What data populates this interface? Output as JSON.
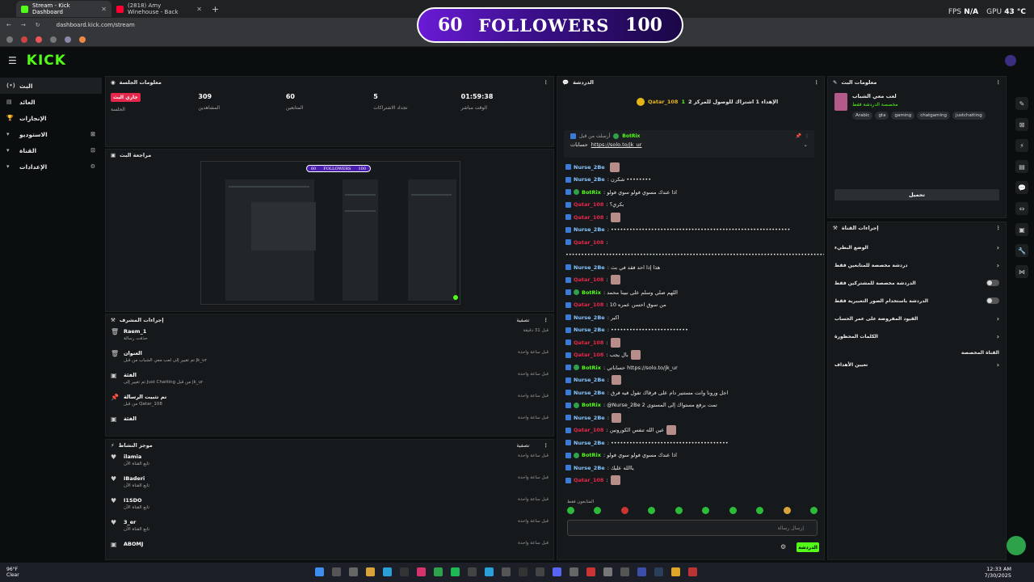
{
  "browser": {
    "tabs": [
      {
        "label": "Stream - Kick Dashboard",
        "color": "#53fc18"
      },
      {
        "label": "(2818) Amy Winehouse - Back",
        "color": "#ff0033"
      }
    ],
    "url": "dashboard.kick.com/stream",
    "fps_label": "FPS",
    "fps_value": "N/A",
    "gpu_label": "GPU",
    "gpu_value": "43 °C"
  },
  "overlay": {
    "current": "60",
    "label": "FOLLOWERS",
    "goal": "100"
  },
  "kick": {
    "logo": "KICK"
  },
  "nav": {
    "items": [
      {
        "label": "البث",
        "icon": "(•)"
      },
      {
        "label": "العائد",
        "icon": "▤"
      },
      {
        "label": "الإنجازات",
        "icon": "🏆"
      },
      {
        "label": "الاستوديو",
        "icon": "▾"
      },
      {
        "label": "القناة",
        "icon": "▾"
      },
      {
        "label": "الإعدادات",
        "icon": "▾"
      }
    ]
  },
  "session": {
    "title": "معلومات الجلسة",
    "live_badge": "جاري البث",
    "live_label": "الجلسة",
    "stats": [
      {
        "value": "309",
        "label": "المشاهدين"
      },
      {
        "value": "60",
        "label": "المتابعين"
      },
      {
        "value": "5",
        "label": "تجداد الاشتراكات"
      },
      {
        "value": "01:59:38",
        "label": "الوقت مباشر"
      }
    ]
  },
  "preview": {
    "title": "مراجعة البث",
    "overlay_current": "60",
    "overlay_label": "FOLLOWERS",
    "overlay_goal": "100"
  },
  "mod_actions": {
    "title": "إجراءات المشرف",
    "filter": "تصفية",
    "rows": [
      {
        "icon": "🗑",
        "title": "Raem_1",
        "sub": "حذفت رسالة",
        "time": "قبل 31 دقيقة"
      },
      {
        "icon": "🗑",
        "title": "العنوان",
        "sub": "تم تغيير إلى لعب معي الشباب من قبل jk_ur",
        "time": "قبل ساعة واحدة"
      },
      {
        "icon": "▣",
        "title": "الفئة",
        "sub": "تم تغيير إلى Just Chatting من قبل jk_ur",
        "time": "قبل ساعة واحدة"
      },
      {
        "icon": "📌",
        "title": "تم تثبيت الرسالة",
        "sub": "من قبل Qatar_108",
        "time": "قبل ساعة واحدة"
      },
      {
        "icon": "▣",
        "title": "الفئة",
        "sub": "",
        "time": "قبل ساعة واحدة"
      }
    ]
  },
  "activity": {
    "title": "موجز النشاط",
    "filter": "تصفية",
    "rows": [
      {
        "name": "ilamia",
        "sub": "تابع القناة الآن",
        "time": "قبل ساعة واحدة"
      },
      {
        "name": "IBaderi",
        "sub": "تابع القناة الآن",
        "time": "قبل ساعة واحدة"
      },
      {
        "name": "I1SDO",
        "sub": "تابع القناة الآن",
        "time": "قبل ساعة واحدة"
      },
      {
        "name": "3_er",
        "sub": "تابع القناة الآن",
        "time": "قبل ساعة واحدة"
      },
      {
        "name": "ABOMJ",
        "sub": "",
        "time": "قبل ساعة واحدة"
      }
    ]
  },
  "chat": {
    "title": "الدردشة",
    "top_user": "Qatar_108",
    "top_count": "1",
    "top_text": "الإهداء 1 اشتراك للوصول للمركز 2",
    "pinned_by": "أرسلت من قبل",
    "pinned_user": "BotRix",
    "pinned_text": "حسابات",
    "pinned_link": "https://solo.to/jk_ur",
    "messages": [
      {
        "user": "Nurse_2Be",
        "color": "#86c5ff",
        "verified": false,
        "text": "",
        "emote": true
      },
      {
        "user": "Nurse_2Be",
        "color": "#86c5ff",
        "verified": false,
        "text": ": شكرن ••••••••",
        "emote": false
      },
      {
        "user": "BotRix",
        "color": "#53fc18",
        "verified": true,
        "text": ": اذا عندك مسوي فولو سوي فولو",
        "emote": false
      },
      {
        "user": "Qatar_108",
        "color": "#e6274b",
        "verified": false,
        "text": ": بكري؟",
        "emote": false
      },
      {
        "user": "Qatar_108",
        "color": "#e6274b",
        "verified": false,
        "text": ":",
        "emote": true
      },
      {
        "user": "Nurse_2Be",
        "color": "#86c5ff",
        "verified": false,
        "text": ": ••••••••••••••••••••••••••••••••••••••••••••••••••••••••••",
        "emote": false
      },
      {
        "user": "Qatar_108",
        "color": "#e6274b",
        "verified": false,
        "text": ":",
        "emote": false
      },
      {
        "user": "",
        "color": "#e8e8e8",
        "verified": false,
        "text": "•••••••••••••••••••••••••••••••••••••••••••••••••••••••••••••••••••••••••••••••••••••••••••••",
        "emote": false
      },
      {
        "user": "Nurse_2Be",
        "color": "#86c5ff",
        "verified": false,
        "text": ": هذا إذا احد فقد في بث",
        "emote": false
      },
      {
        "user": "Qatar_108",
        "color": "#e6274b",
        "verified": false,
        "text": ":",
        "emote": true
      },
      {
        "user": "BotRix",
        "color": "#53fc18",
        "verified": true,
        "text": ": اللهم صلي وسلم على نبينا محمد",
        "emote": false
      },
      {
        "user": "Qatar_108",
        "color": "#e6274b",
        "verified": false,
        "text": ": من سوق احسن عمره 10",
        "emote": false
      },
      {
        "user": "Nurse_2Be",
        "color": "#86c5ff",
        "verified": false,
        "text": ": اكبر",
        "emote": false
      },
      {
        "user": "Nurse_2Be",
        "color": "#86c5ff",
        "verified": false,
        "text": ": •••••••••••••••••••••••••",
        "emote": false
      },
      {
        "user": "Qatar_108",
        "color": "#e6274b",
        "verified": false,
        "text": ":",
        "emote": true
      },
      {
        "user": "Qatar_108",
        "color": "#e6274b",
        "verified": false,
        "text": ": بال يجب",
        "emote": true
      },
      {
        "user": "BotRix",
        "color": "#53fc18",
        "verified": true,
        "text": ": حساباتي https://solo.to/jk_ur",
        "emote": false
      },
      {
        "user": "Nurse_2Be",
        "color": "#86c5ff",
        "verified": false,
        "text": ":",
        "emote": true
      },
      {
        "user": "Nurse_2Be",
        "color": "#86c5ff",
        "verified": false,
        "text": ": اجل ورونا وانت مستنير دام على فرقاك تقول فيه فرق",
        "emote": false
      },
      {
        "user": "BotRix",
        "color": "#53fc18",
        "verified": true,
        "text": ": @Nurse_2Be 2 تمت برفع مستواك إلى المستوى",
        "emote": false
      },
      {
        "user": "Nurse_2Be",
        "color": "#86c5ff",
        "verified": false,
        "text": ":",
        "emote": true
      },
      {
        "user": "Qatar_108",
        "color": "#e6274b",
        "verified": false,
        "text": ": عين الله تنفس الكورونين",
        "emote": true
      },
      {
        "user": "Nurse_2Be",
        "color": "#86c5ff",
        "verified": false,
        "text": ": ••••••••••••••••••••••••••••••••••••••",
        "emote": false
      },
      {
        "user": "BotRix",
        "color": "#53fc18",
        "verified": true,
        "text": ": اذا عندك مسوي فولو سوي فولو",
        "emote": false
      },
      {
        "user": "Nurse_2Be",
        "color": "#86c5ff",
        "verified": false,
        "text": ": ياالله عليك",
        "emote": false
      },
      {
        "user": "Qatar_108",
        "color": "#e6274b",
        "verified": false,
        "text": ":",
        "emote": true
      }
    ],
    "followers_only": "المتابعون فقط",
    "input_placeholder": "إرسال رسالة",
    "send_label": "الدردشة"
  },
  "stream_info": {
    "title": "معلومات البث",
    "stream_title": "لعب معي الشباب",
    "category": "مخصصة الدردشة فقط",
    "tags": [
      "Arabic",
      "gta",
      "gaming",
      "chatgaming",
      "justchatting"
    ],
    "edit_label": "تحميل"
  },
  "channel_actions": {
    "title": "إجراءات القناة",
    "rows": [
      {
        "label": "الوضع البطيء",
        "control": "chevron"
      },
      {
        "label": "دردشة مخصصة للمتابعين فقط",
        "control": "chevron"
      },
      {
        "label": "الدردشة مخصصة للمشتركين فقط",
        "control": "toggle"
      },
      {
        "label": "الدردشة باستخدام الصور التعبيرية فقط",
        "control": "toggle"
      },
      {
        "label": "القيود المفروضة على عمر الحساب",
        "control": "chevron"
      },
      {
        "label": "الكلمات المحظورة",
        "control": "chevron"
      }
    ],
    "custom_label": "القناة المخصصة",
    "goals_label": "تعيين الأهداف"
  },
  "taskbar": {
    "temp": "96°F",
    "weather": "Clear",
    "time": "12:33 AM",
    "date": "7/30/2025"
  }
}
